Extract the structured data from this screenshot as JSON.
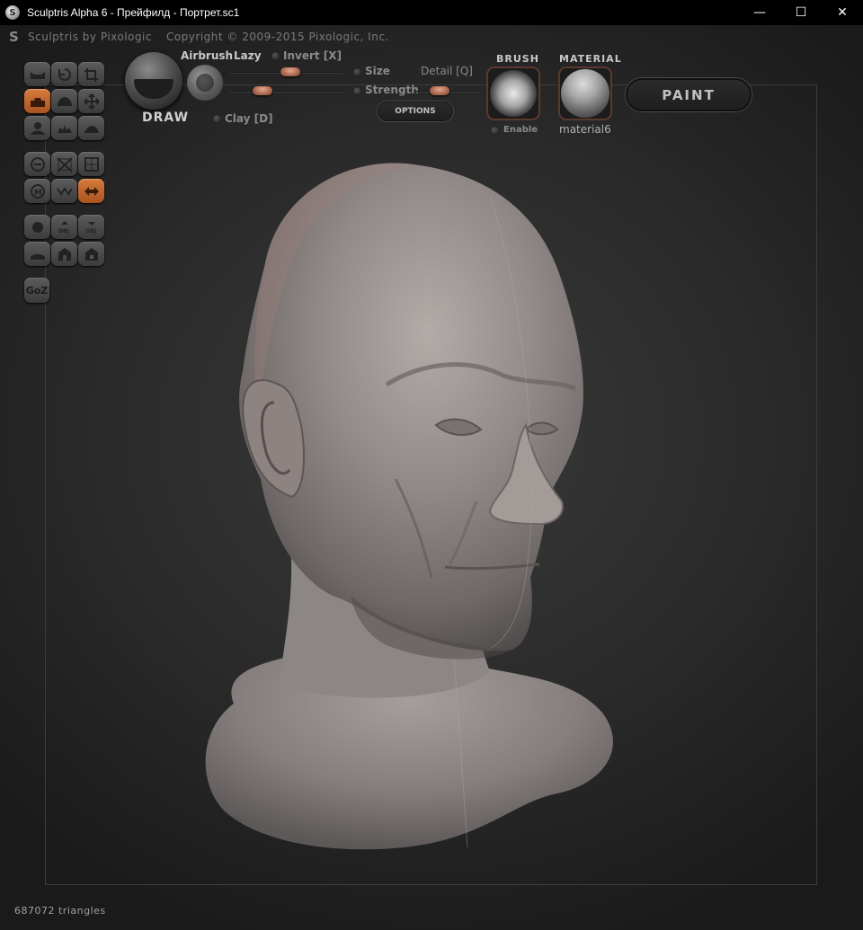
{
  "window": {
    "title": "Sculptris Alpha 6 - Прейфилд - Портрет.sc1",
    "minimize": "—",
    "maximize": "☐",
    "close": "✕"
  },
  "brandline": {
    "product": "Sculptris by Pixologic",
    "copyright": "Copyright © 2009-2015 Pixologic, Inc."
  },
  "tools": [
    {
      "name": "tool-flatten",
      "icon": "flatten-icon",
      "active": false
    },
    {
      "name": "tool-rotate",
      "icon": "rotate-icon",
      "active": false
    },
    {
      "name": "tool-crop",
      "icon": "crop-icon",
      "active": false
    },
    {
      "name": "tool-draw",
      "icon": "draw-icon",
      "active": true
    },
    {
      "name": "tool-inflate",
      "icon": "inflate-icon",
      "active": false
    },
    {
      "name": "tool-grab",
      "icon": "grab-icon",
      "active": false
    },
    {
      "name": "tool-pinch",
      "icon": "pinch-icon",
      "active": false
    },
    {
      "name": "tool-crease",
      "icon": "crease-icon",
      "active": false
    },
    {
      "name": "tool-smooth",
      "icon": "smooth-icon",
      "active": false
    },
    {
      "name": "tool-reduce",
      "icon": "reduce-icon",
      "active": false
    },
    {
      "name": "tool-mask",
      "icon": "mask-icon",
      "active": false
    },
    {
      "name": "tool-wireframe",
      "icon": "grid-icon",
      "active": false
    },
    {
      "name": "tool-material-m",
      "icon": "m-icon",
      "active": false
    },
    {
      "name": "tool-wire",
      "icon": "wave-icon",
      "active": false
    },
    {
      "name": "tool-symmetry",
      "icon": "symmetry-icon",
      "active": true
    },
    {
      "name": "tool-sphere",
      "icon": "sphere-icon",
      "active": false
    },
    {
      "name": "tool-import-obj",
      "icon": "import-obj-icon",
      "label": "OBJ",
      "active": false
    },
    {
      "name": "tool-export-obj",
      "icon": "export-obj-icon",
      "label": "OBJ",
      "active": false
    },
    {
      "name": "tool-plane",
      "icon": "plane-icon",
      "active": false
    },
    {
      "name": "tool-open",
      "icon": "open-icon",
      "active": false
    },
    {
      "name": "tool-save",
      "icon": "save-icon",
      "active": false
    }
  ],
  "goz": {
    "label": "GoZ"
  },
  "brush": {
    "name": "DRAW",
    "airbrush": "Airbrush",
    "lazy": "Lazy",
    "invert": "Invert [X]",
    "size": "Size",
    "detail": "Detail [Q]",
    "strength": "Strength",
    "clay": "Clay [D]",
    "options": "OPTIONS",
    "size_level": 0.55,
    "lazy_level": 0.25,
    "strength_level": 0.3
  },
  "brush_panel": {
    "heading": "BRUSH",
    "enable": "Enable"
  },
  "material_panel": {
    "heading": "MATERIAL",
    "name": "material6"
  },
  "paint_button": "PAINT",
  "status": "687072 triangles",
  "colors": {
    "accent": "#c8652a",
    "background": "#2c2c2c"
  }
}
